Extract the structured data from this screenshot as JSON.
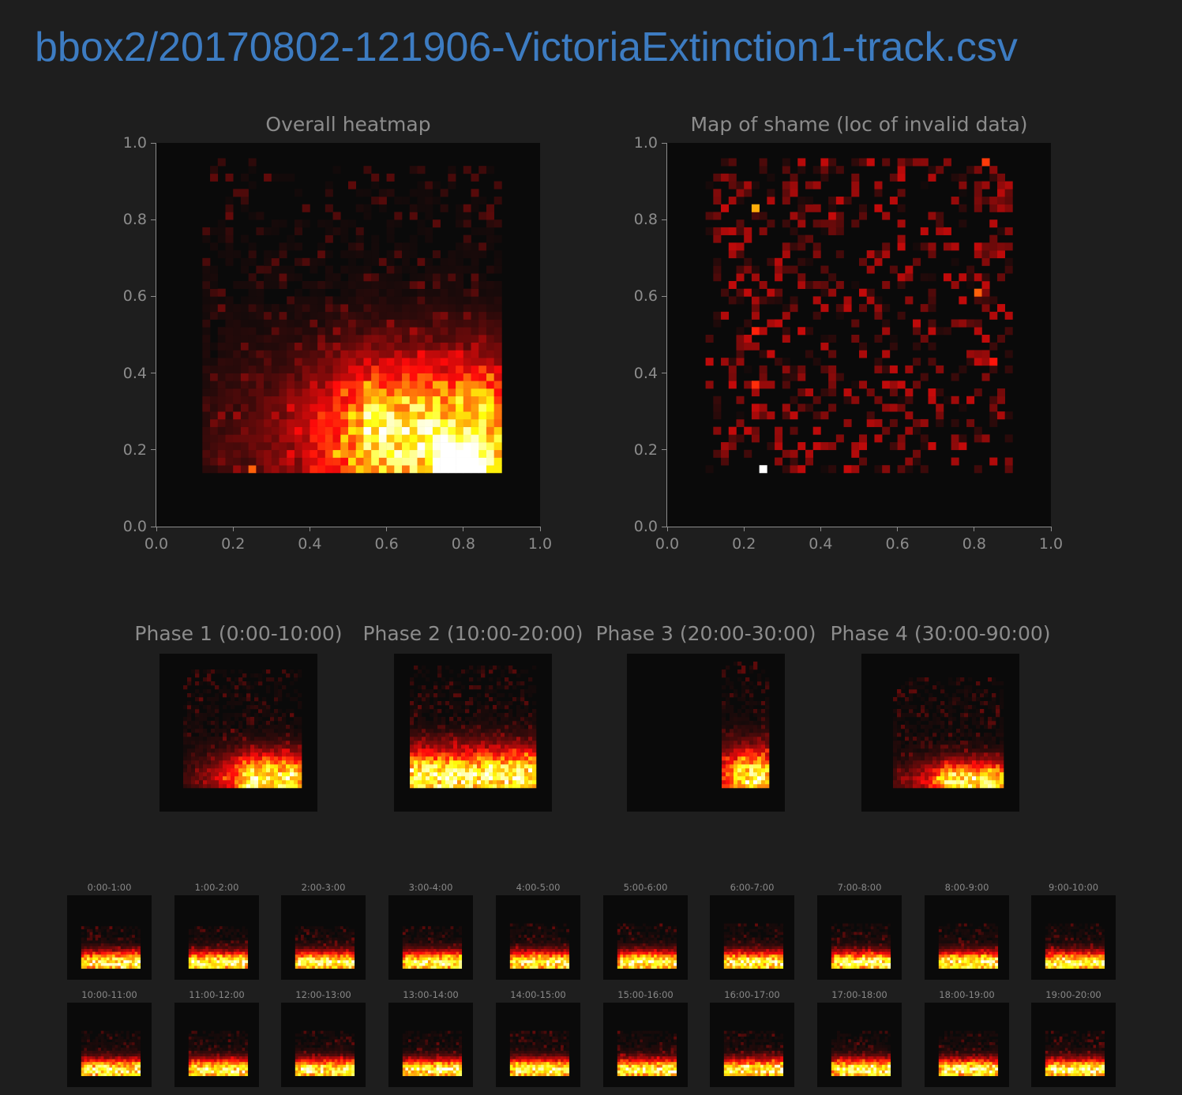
{
  "title": "bbox2/20170802-121906-VictoriaExtinction1-track.csv",
  "colors": {
    "background": "#1e1e1e",
    "title": "#3d7cc2",
    "axis_text": "#8c8c8c",
    "colormap": "hot"
  },
  "chart_data": [
    {
      "id": "overall",
      "type": "heatmap",
      "title": "Overall heatmap",
      "xlim": [
        0,
        1
      ],
      "ylim": [
        0,
        1
      ],
      "xticks": [
        "0.0",
        "0.2",
        "0.4",
        "0.6",
        "0.8",
        "1.0"
      ],
      "yticks": [
        "0.0",
        "0.2",
        "0.4",
        "0.6",
        "0.8",
        "1.0"
      ],
      "bins": 50,
      "distribution": {
        "occupied_x": [
          0.12,
          0.9
        ],
        "occupied_y": [
          0.15,
          0.95
        ],
        "peak": [
          0.79,
          0.15
        ],
        "hot_band": {
          "x": [
            0.55,
            0.86
          ],
          "y": [
            0.15,
            0.32
          ]
        },
        "isolated_hot_cell": [
          0.25,
          0.15
        ]
      }
    },
    {
      "id": "shame",
      "type": "heatmap",
      "title": "Map of shame (loc of invalid data)",
      "xlim": [
        0,
        1
      ],
      "ylim": [
        0,
        1
      ],
      "xticks": [
        "0.0",
        "0.2",
        "0.4",
        "0.6",
        "0.8",
        "1.0"
      ],
      "yticks": [
        "0.0",
        "0.2",
        "0.4",
        "0.6",
        "0.8",
        "1.0"
      ],
      "bins": 50,
      "distribution": {
        "occupied_x": [
          0.1,
          0.9
        ],
        "occupied_y": [
          0.15,
          0.95
        ],
        "peak": [
          0.25,
          0.15
        ],
        "notable_cells": [
          [
            0.23,
            0.83
          ],
          [
            0.81,
            0.61
          ],
          [
            0.82,
            0.95
          ],
          [
            0.22,
            0.51
          ],
          [
            0.23,
            0.37
          ],
          [
            0.84,
            0.43
          ]
        ]
      }
    },
    {
      "id": "phase1",
      "type": "heatmap",
      "title": "Phase 1 (0:00-10:00)",
      "distribution": {
        "x": [
          0.15,
          0.9
        ],
        "y": [
          0.15,
          0.9
        ],
        "hot": {
          "x": [
            0.55,
            0.85
          ],
          "y": [
            0.15,
            0.28
          ]
        }
      }
    },
    {
      "id": "phase2",
      "type": "heatmap",
      "title": "Phase 2 (10:00-20:00)",
      "distribution": {
        "x": [
          0.1,
          0.9
        ],
        "y": [
          0.15,
          0.92
        ],
        "hot": {
          "x": [
            0.12,
            0.88
          ],
          "y": [
            0.15,
            0.3
          ]
        }
      }
    },
    {
      "id": "phase3",
      "type": "heatmap",
      "title": "Phase 3 (20:00-30:00)",
      "distribution": {
        "x": [
          0.6,
          0.9
        ],
        "y": [
          0.15,
          0.95
        ],
        "hot": {
          "x": [
            0.72,
            0.86
          ],
          "y": [
            0.15,
            0.3
          ]
        }
      }
    },
    {
      "id": "phase4",
      "type": "heatmap",
      "title": "Phase 4 (30:00-90:00)",
      "distribution": {
        "x": [
          0.2,
          0.9
        ],
        "y": [
          0.15,
          0.85
        ],
        "hot": {
          "x": [
            0.55,
            0.85
          ],
          "y": [
            0.15,
            0.25
          ]
        }
      }
    },
    {
      "id": "m0",
      "type": "heatmap",
      "title": "0:00-1:00"
    },
    {
      "id": "m1",
      "type": "heatmap",
      "title": "1:00-2:00"
    },
    {
      "id": "m2",
      "type": "heatmap",
      "title": "2:00-3:00"
    },
    {
      "id": "m3",
      "type": "heatmap",
      "title": "3:00-4:00"
    },
    {
      "id": "m4",
      "type": "heatmap",
      "title": "4:00-5:00"
    },
    {
      "id": "m5",
      "type": "heatmap",
      "title": "5:00-6:00"
    },
    {
      "id": "m6",
      "type": "heatmap",
      "title": "6:00-7:00"
    },
    {
      "id": "m7",
      "type": "heatmap",
      "title": "7:00-8:00"
    },
    {
      "id": "m8",
      "type": "heatmap",
      "title": "8:00-9:00"
    },
    {
      "id": "m9",
      "type": "heatmap",
      "title": "9:00-10:00"
    },
    {
      "id": "m10",
      "type": "heatmap",
      "title": "10:00-11:00"
    },
    {
      "id": "m11",
      "type": "heatmap",
      "title": "11:00-12:00"
    },
    {
      "id": "m12",
      "type": "heatmap",
      "title": "12:00-13:00"
    },
    {
      "id": "m13",
      "type": "heatmap",
      "title": "13:00-14:00"
    },
    {
      "id": "m14",
      "type": "heatmap",
      "title": "14:00-15:00"
    },
    {
      "id": "m15",
      "type": "heatmap",
      "title": "15:00-16:00"
    },
    {
      "id": "m16",
      "type": "heatmap",
      "title": "16:00-17:00"
    },
    {
      "id": "m17",
      "type": "heatmap",
      "title": "17:00-18:00"
    },
    {
      "id": "m18",
      "type": "heatmap",
      "title": "18:00-19:00"
    },
    {
      "id": "m19",
      "type": "heatmap",
      "title": "19:00-20:00"
    }
  ]
}
